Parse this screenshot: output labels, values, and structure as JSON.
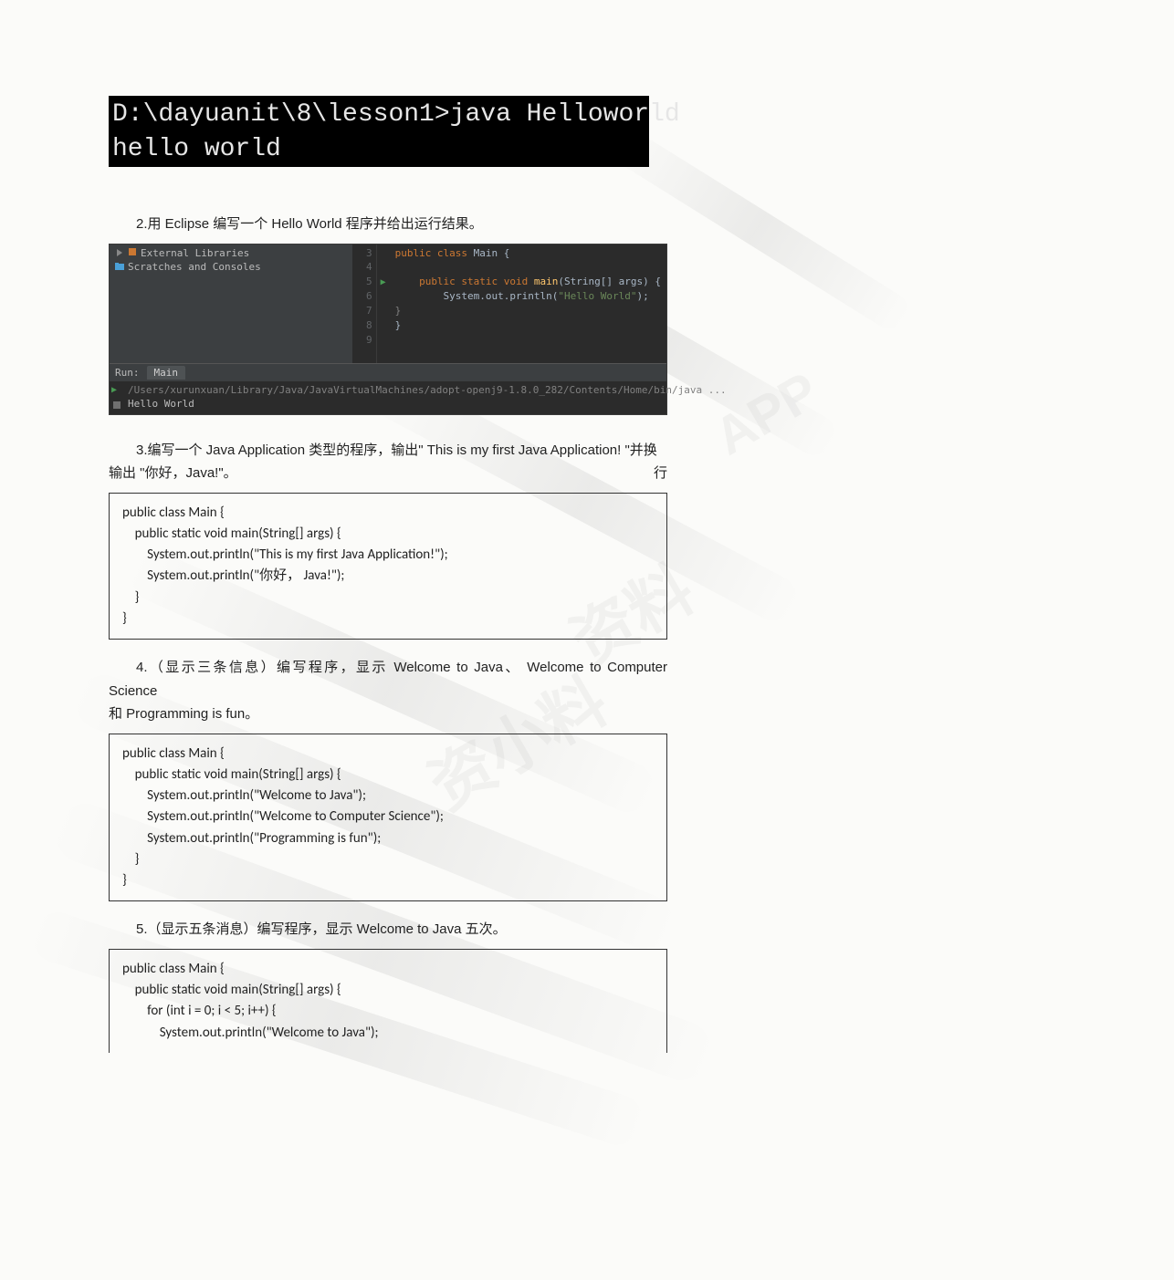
{
  "terminal": {
    "line1": "D:\\dayuanit\\8\\lesson1>java Helloworld",
    "line2": "hello world"
  },
  "q2": {
    "text": "2.用 Eclipse 编写一个 Hello World 程序并给出运行结果。"
  },
  "ide": {
    "tree": {
      "row1": "External Libraries",
      "row2": "Scratches and Consoles"
    },
    "gutter": "3\n4\n5\n6\n7\n8\n9",
    "code_l1_a": "public class ",
    "code_l1_b": "Main {",
    "code_l2_a": "    public static void ",
    "code_l2_b": "main",
    "code_l2_c": "(String[] args) {",
    "code_l3_a": "        System.",
    "code_l3_b": "out",
    "code_l3_c": ".println(",
    "code_l3_d": "\"Hello World\"",
    "code_l3_e": ");",
    "code_l4": "    }",
    "code_l5": "}",
    "run_label": "Run:",
    "run_tab": "Main",
    "console_path": "/Users/xurunxuan/Library/Java/JavaVirtualMachines/adopt-openj9-1.8.0_282/Contents/Home/bin/java ...",
    "console_out": "Hello World"
  },
  "q3": {
    "line1_lead": "3.编写一个 Java Application 类型的程序，输出\" This is my first Java Application! \"并换",
    "line1_tail": "行",
    "line2": "输出 \"你好，Java!\"。"
  },
  "code3": "public class Main {\n    public static void main(String[] args) {\n        System.out.println(\"This is my first Java Application!\");\n        System.out.println(\"你好， Java!\");\n    }\n}",
  "q4": {
    "line1": "4.（显示三条信息）编写程序，显示 Welcome to Java、 Welcome to Computer Science",
    "line2": "和 Programming is fun。"
  },
  "code4": "public class Main {\n    public static void main(String[] args) {\n        System.out.println(\"Welcome to Java\");\n        System.out.println(\"Welcome to Computer Science\");\n        System.out.println(\"Programming is fun\");\n    }\n}",
  "q5": {
    "text": "5.（显示五条消息）编写程序，显示 Welcome to Java 五次。"
  },
  "code5": "public class Main {\n    public static void main(String[] args) {\n        for (int i = 0; i < 5; i++) {\n            System.out.println(\"Welcome to Java\");",
  "watermark": {
    "text1": "资小料",
    "text2": "APP",
    "text3": "资料"
  }
}
